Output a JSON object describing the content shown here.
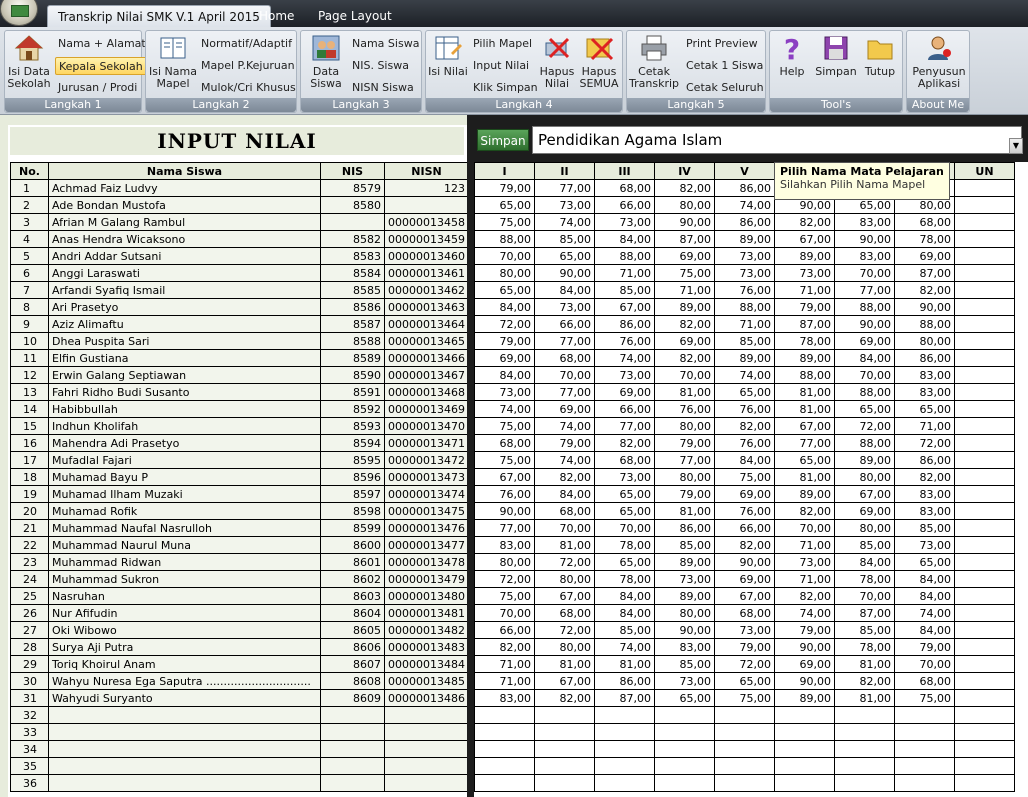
{
  "tabs": [
    {
      "label": "Transkrip Nilai SMK V.1 April 2015",
      "active": true
    },
    {
      "label": "Home",
      "active": false
    },
    {
      "label": "Page Layout",
      "active": false
    }
  ],
  "ribbon": {
    "langkah1": {
      "label": "Langkah 1",
      "big": "Isi Data Sekolah",
      "nama_alamat": "Nama + Alamat",
      "kepala": "Kepala Sekolah",
      "jurusan": "Jurusan / Prodi"
    },
    "langkah2": {
      "label": "Langkah 2",
      "big": "Isi Nama Mapel",
      "normatif": "Normatif/Adaptif",
      "kejuruan": "Mapel P.Kejuruan",
      "mulok": "Mulok/Cri Khusus"
    },
    "langkah3": {
      "label": "Langkah 3",
      "big": "Data Siswa",
      "nama": "Nama Siswa",
      "nis": "NIS. Siswa",
      "nisn": "NISN Siswa"
    },
    "langkah4": {
      "label": "Langkah 4",
      "big": "Isi Nilai",
      "pilih": "Pilih Mapel",
      "input": "Input Nilai",
      "klik": "Klik Simpan",
      "hapus": "Hapus Nilai",
      "hapus_semua": "Hapus SEMUA"
    },
    "langkah5": {
      "label": "Langkah 5",
      "big": "Cetak Transkrip",
      "print": "Print Preview",
      "cetak1": "Cetak 1 Siswa",
      "cetak_all": "Cetak Seluruh"
    },
    "tools": {
      "label": "Tool's",
      "help": "Help",
      "simpan": "Simpan",
      "tutup": "Tutup"
    },
    "about": {
      "label": "About Me",
      "penyusun": "Penyusun Aplikasi"
    }
  },
  "sheet": {
    "title": "INPUT NILAI",
    "headers": {
      "no": "No.",
      "nama": "Nama Siswa",
      "nis": "NIS",
      "nisn": "NISN"
    },
    "simpan": "Simpan",
    "mapel": "Pendidikan Agama Islam",
    "grade_headers": [
      "I",
      "II",
      "III",
      "IV",
      "V",
      "",
      "",
      "",
      "UN"
    ],
    "tooltip": {
      "title": "Pilih Nama Mata Pelajaran",
      "body": "Silahkan Pilih Nama Mapel"
    }
  },
  "students": [
    {
      "no": "1",
      "nama": "Achmad Faiz Ludvy",
      "nis": "8579",
      "nisn": "123",
      "nilai": [
        "79,00",
        "77,00",
        "68,00",
        "82,00",
        "86,00",
        "",
        "",
        "",
        ""
      ]
    },
    {
      "no": "2",
      "nama": "Ade Bondan Mustofa",
      "nis": "8580",
      "nisn": "",
      "nilai": [
        "65,00",
        "73,00",
        "66,00",
        "80,00",
        "74,00",
        "90,00",
        "65,00",
        "80,00",
        ""
      ]
    },
    {
      "no": "3",
      "nama": "Afrian M Galang Rambul",
      "nis": "",
      "nisn": "00000013458",
      "nilai": [
        "75,00",
        "74,00",
        "73,00",
        "90,00",
        "86,00",
        "82,00",
        "83,00",
        "68,00",
        ""
      ]
    },
    {
      "no": "4",
      "nama": "Anas Hendra Wicaksono",
      "nis": "8582",
      "nisn": "00000013459",
      "nilai": [
        "88,00",
        "85,00",
        "84,00",
        "87,00",
        "89,00",
        "67,00",
        "90,00",
        "78,00",
        ""
      ]
    },
    {
      "no": "5",
      "nama": "Andri Addar Sutsani",
      "nis": "8583",
      "nisn": "00000013460",
      "nilai": [
        "70,00",
        "65,00",
        "88,00",
        "69,00",
        "73,00",
        "89,00",
        "83,00",
        "69,00",
        ""
      ]
    },
    {
      "no": "6",
      "nama": "Anggi Laraswati",
      "nis": "8584",
      "nisn": "00000013461",
      "nilai": [
        "80,00",
        "90,00",
        "71,00",
        "75,00",
        "73,00",
        "73,00",
        "70,00",
        "87,00",
        ""
      ]
    },
    {
      "no": "7",
      "nama": "Arfandi Syafiq Ismail",
      "nis": "8585",
      "nisn": "00000013462",
      "nilai": [
        "65,00",
        "84,00",
        "85,00",
        "71,00",
        "76,00",
        "71,00",
        "77,00",
        "82,00",
        ""
      ]
    },
    {
      "no": "8",
      "nama": "Ari Prasetyo",
      "nis": "8586",
      "nisn": "00000013463",
      "nilai": [
        "84,00",
        "73,00",
        "67,00",
        "89,00",
        "88,00",
        "79,00",
        "88,00",
        "90,00",
        ""
      ]
    },
    {
      "no": "9",
      "nama": "Aziz Alimaftu",
      "nis": "8587",
      "nisn": "00000013464",
      "nilai": [
        "72,00",
        "66,00",
        "86,00",
        "82,00",
        "71,00",
        "87,00",
        "90,00",
        "88,00",
        ""
      ]
    },
    {
      "no": "10",
      "nama": "Dhea Puspita Sari",
      "nis": "8588",
      "nisn": "00000013465",
      "nilai": [
        "79,00",
        "77,00",
        "76,00",
        "69,00",
        "85,00",
        "78,00",
        "69,00",
        "80,00",
        ""
      ]
    },
    {
      "no": "11",
      "nama": "Elfin Gustiana",
      "nis": "8589",
      "nisn": "00000013466",
      "nilai": [
        "69,00",
        "68,00",
        "74,00",
        "82,00",
        "89,00",
        "89,00",
        "84,00",
        "86,00",
        ""
      ]
    },
    {
      "no": "12",
      "nama": "Erwin Galang Septiawan",
      "nis": "8590",
      "nisn": "00000013467",
      "nilai": [
        "84,00",
        "70,00",
        "73,00",
        "70,00",
        "74,00",
        "88,00",
        "70,00",
        "83,00",
        ""
      ]
    },
    {
      "no": "13",
      "nama": "Fahri Ridho Budi Susanto",
      "nis": "8591",
      "nisn": "00000013468",
      "nilai": [
        "73,00",
        "77,00",
        "69,00",
        "81,00",
        "65,00",
        "81,00",
        "88,00",
        "83,00",
        ""
      ]
    },
    {
      "no": "14",
      "nama": "Habibbullah",
      "nis": "8592",
      "nisn": "00000013469",
      "nilai": [
        "74,00",
        "69,00",
        "66,00",
        "76,00",
        "76,00",
        "81,00",
        "65,00",
        "65,00",
        ""
      ]
    },
    {
      "no": "15",
      "nama": "Indhun Kholifah",
      "nis": "8593",
      "nisn": "00000013470",
      "nilai": [
        "75,00",
        "74,00",
        "77,00",
        "80,00",
        "82,00",
        "67,00",
        "72,00",
        "71,00",
        ""
      ]
    },
    {
      "no": "16",
      "nama": "Mahendra Adi Prasetyo",
      "nis": "8594",
      "nisn": "00000013471",
      "nilai": [
        "68,00",
        "79,00",
        "82,00",
        "79,00",
        "76,00",
        "77,00",
        "88,00",
        "72,00",
        ""
      ]
    },
    {
      "no": "17",
      "nama": "Mufadlal Fajari",
      "nis": "8595",
      "nisn": "00000013472",
      "nilai": [
        "75,00",
        "74,00",
        "68,00",
        "77,00",
        "84,00",
        "65,00",
        "89,00",
        "86,00",
        ""
      ]
    },
    {
      "no": "18",
      "nama": "Muhamad Bayu P",
      "nis": "8596",
      "nisn": "00000013473",
      "nilai": [
        "67,00",
        "82,00",
        "73,00",
        "80,00",
        "75,00",
        "81,00",
        "80,00",
        "82,00",
        ""
      ]
    },
    {
      "no": "19",
      "nama": "Muhamad Ilham Muzaki",
      "nis": "8597",
      "nisn": "00000013474",
      "nilai": [
        "76,00",
        "84,00",
        "65,00",
        "79,00",
        "69,00",
        "89,00",
        "67,00",
        "83,00",
        ""
      ]
    },
    {
      "no": "20",
      "nama": "Muhamad Rofik",
      "nis": "8598",
      "nisn": "00000013475",
      "nilai": [
        "90,00",
        "68,00",
        "65,00",
        "81,00",
        "76,00",
        "82,00",
        "69,00",
        "83,00",
        ""
      ]
    },
    {
      "no": "21",
      "nama": "Muhammad Naufal Nasrulloh",
      "nis": "8599",
      "nisn": "00000013476",
      "nilai": [
        "77,00",
        "70,00",
        "70,00",
        "86,00",
        "66,00",
        "70,00",
        "80,00",
        "85,00",
        ""
      ]
    },
    {
      "no": "22",
      "nama": "Muhammad Naurul Muna",
      "nis": "8600",
      "nisn": "00000013477",
      "nilai": [
        "83,00",
        "81,00",
        "78,00",
        "85,00",
        "82,00",
        "71,00",
        "85,00",
        "73,00",
        ""
      ]
    },
    {
      "no": "23",
      "nama": "Muhammad Ridwan",
      "nis": "8601",
      "nisn": "00000013478",
      "nilai": [
        "80,00",
        "72,00",
        "65,00",
        "89,00",
        "90,00",
        "73,00",
        "84,00",
        "65,00",
        ""
      ]
    },
    {
      "no": "24",
      "nama": "Muhammad Sukron",
      "nis": "8602",
      "nisn": "00000013479",
      "nilai": [
        "72,00",
        "80,00",
        "78,00",
        "73,00",
        "69,00",
        "71,00",
        "78,00",
        "84,00",
        ""
      ]
    },
    {
      "no": "25",
      "nama": "Nasruhan",
      "nis": "8603",
      "nisn": "00000013480",
      "nilai": [
        "75,00",
        "67,00",
        "84,00",
        "89,00",
        "67,00",
        "82,00",
        "70,00",
        "84,00",
        ""
      ]
    },
    {
      "no": "26",
      "nama": "Nur Afifudin",
      "nis": "8604",
      "nisn": "00000013481",
      "nilai": [
        "70,00",
        "68,00",
        "84,00",
        "80,00",
        "68,00",
        "74,00",
        "87,00",
        "74,00",
        ""
      ]
    },
    {
      "no": "27",
      "nama": "Oki Wibowo",
      "nis": "8605",
      "nisn": "00000013482",
      "nilai": [
        "66,00",
        "72,00",
        "85,00",
        "90,00",
        "73,00",
        "79,00",
        "85,00",
        "84,00",
        ""
      ]
    },
    {
      "no": "28",
      "nama": "Surya Aji Putra",
      "nis": "8606",
      "nisn": "00000013483",
      "nilai": [
        "82,00",
        "80,00",
        "74,00",
        "83,00",
        "79,00",
        "90,00",
        "78,00",
        "79,00",
        ""
      ]
    },
    {
      "no": "29",
      "nama": "Toriq Khoirul Anam",
      "nis": "8607",
      "nisn": "00000013484",
      "nilai": [
        "71,00",
        "81,00",
        "81,00",
        "85,00",
        "72,00",
        "69,00",
        "81,00",
        "70,00",
        ""
      ]
    },
    {
      "no": "30",
      "nama": "Wahyu Nuresa Ega Saputra ..............................",
      "nis": "8608",
      "nisn": "00000013485",
      "nilai": [
        "71,00",
        "67,00",
        "86,00",
        "73,00",
        "65,00",
        "90,00",
        "82,00",
        "68,00",
        ""
      ]
    },
    {
      "no": "31",
      "nama": "Wahyudi Suryanto",
      "nis": "8609",
      "nisn": "00000013486",
      "nilai": [
        "83,00",
        "82,00",
        "87,00",
        "65,00",
        "75,00",
        "89,00",
        "81,00",
        "75,00",
        ""
      ]
    },
    {
      "no": "32",
      "nama": "",
      "nis": "",
      "nisn": "",
      "nilai": [
        "",
        "",
        "",
        "",
        "",
        "",
        "",
        "",
        ""
      ]
    },
    {
      "no": "33",
      "nama": "",
      "nis": "",
      "nisn": "",
      "nilai": [
        "",
        "",
        "",
        "",
        "",
        "",
        "",
        "",
        ""
      ]
    },
    {
      "no": "34",
      "nama": "",
      "nis": "",
      "nisn": "",
      "nilai": [
        "",
        "",
        "",
        "",
        "",
        "",
        "",
        "",
        ""
      ]
    },
    {
      "no": "35",
      "nama": "",
      "nis": "",
      "nisn": "",
      "nilai": [
        "",
        "",
        "",
        "",
        "",
        "",
        "",
        "",
        ""
      ]
    },
    {
      "no": "36",
      "nama": "",
      "nis": "",
      "nisn": "",
      "nilai": [
        "",
        "",
        "",
        "",
        "",
        "",
        "",
        "",
        ""
      ]
    }
  ]
}
